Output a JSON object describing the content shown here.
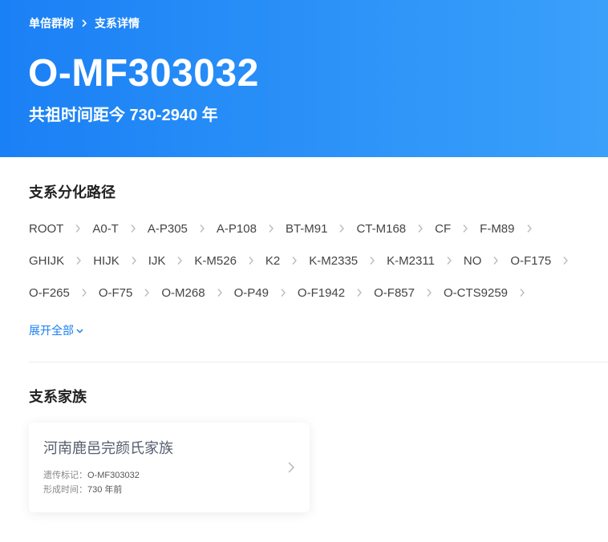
{
  "breadcrumb": {
    "items": [
      "单倍群树",
      "支系详情"
    ]
  },
  "hero": {
    "title": "O-MF303032",
    "subtitle": "共祖时间距今 730-2940 年"
  },
  "path_section": {
    "title": "支系分化路径",
    "nodes": [
      "ROOT",
      "A0-T",
      "A-P305",
      "A-P108",
      "BT-M91",
      "CT-M168",
      "CF",
      "F-M89",
      "GHIJK",
      "HIJK",
      "IJK",
      "K-M526",
      "K2",
      "K-M2335",
      "K-M2311",
      "NO",
      "O-F175",
      "O-F265",
      "O-F75",
      "O-M268",
      "O-P49",
      "O-F1942",
      "O-F857",
      "O-CTS9259"
    ],
    "expand_label": "展开全部"
  },
  "clan_section": {
    "title": "支系家族",
    "card": {
      "name": "河南鹿邑完颜氏家族",
      "marker_label": "遗传标记：",
      "marker_value": "O-MF303032",
      "time_label": "形成时间：",
      "time_value": "730 年前"
    }
  },
  "colors": {
    "banner_start": "#1a80f5",
    "banner_end": "#3aa0fa",
    "link": "#1a7ff0"
  }
}
